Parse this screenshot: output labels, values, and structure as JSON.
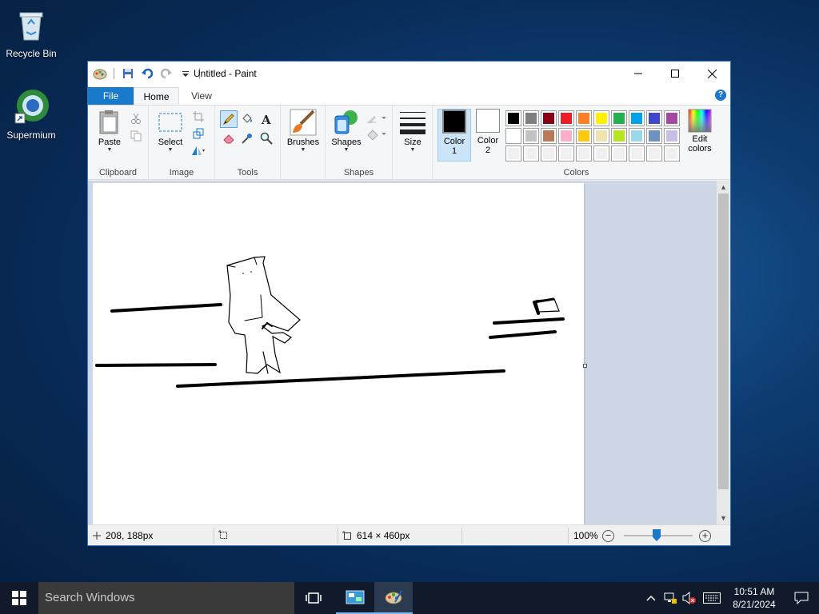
{
  "desktop": {
    "icons": [
      {
        "label": "Recycle Bin",
        "icon": "recycle-bin-icon"
      },
      {
        "label": "Supermium",
        "icon": "supermium-browser-icon"
      }
    ]
  },
  "window": {
    "title": "Untitled - Paint",
    "controls": [
      "minimize",
      "maximize",
      "close"
    ]
  },
  "tabs": {
    "file": "File",
    "home": "Home",
    "view": "View",
    "active": "Home"
  },
  "ribbon": {
    "clipboard": {
      "label": "Clipboard",
      "paste": "Paste"
    },
    "image": {
      "label": "Image",
      "select": "Select"
    },
    "tools": {
      "label": "Tools",
      "active_tool": "pencil"
    },
    "brushes": {
      "label": "Brushes"
    },
    "shapes": {
      "label": "Shapes",
      "shapes_btn": "Shapes"
    },
    "size": {
      "label": "Size"
    },
    "colors": {
      "label": "Colors",
      "color1_label": "Color",
      "color1_num": "1",
      "color2_label": "Color",
      "color2_num": "2",
      "color1": "#000000",
      "color2": "#ffffff",
      "edit_colors_line1": "Edit",
      "edit_colors_line2": "colors",
      "palette_row1": [
        "#000000",
        "#7f7f7f",
        "#880015",
        "#ed1c24",
        "#ff7f27",
        "#fff200",
        "#22b14c",
        "#00a2e8",
        "#3f48cc",
        "#a349a4"
      ],
      "palette_row2": [
        "#ffffff",
        "#c3c3c3",
        "#b97a57",
        "#ffaec9",
        "#ffc90e",
        "#efe4b0",
        "#b5e61d",
        "#99d9ea",
        "#7092be",
        "#c8bfe7"
      ],
      "palette_row3": [
        "#ffffff",
        "#ffffff",
        "#ffffff",
        "#ffffff",
        "#ffffff",
        "#ffffff",
        "#ffffff",
        "#ffffff",
        "#ffffff",
        "#ffffff"
      ]
    }
  },
  "status": {
    "cursor_pos": "208, 188px",
    "selection_size": "",
    "canvas_size": "614 × 460px",
    "zoom": "100%"
  },
  "taskbar": {
    "search_placeholder": "Search Windows",
    "time": "10:51 AM",
    "date": "8/21/2024"
  }
}
